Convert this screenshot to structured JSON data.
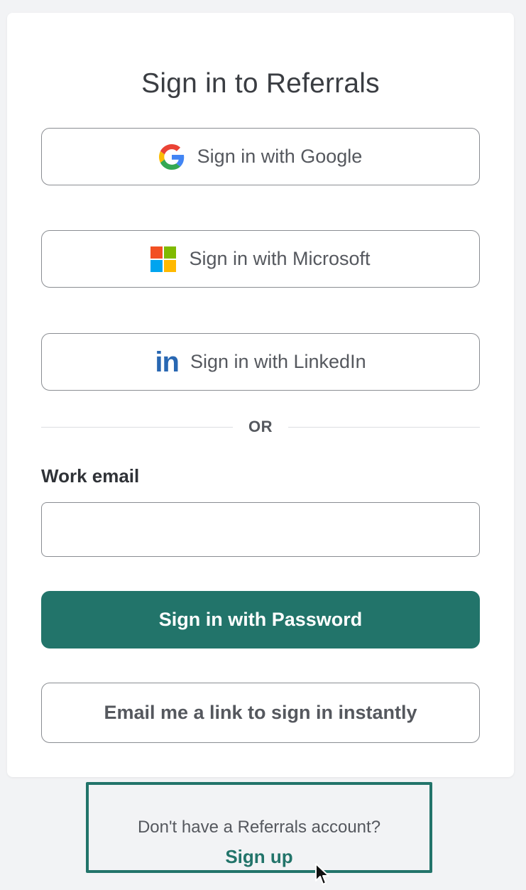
{
  "page": {
    "title": "Sign in to Referrals"
  },
  "oauth": {
    "google_label": "Sign in with Google",
    "microsoft_label": "Sign in with Microsoft",
    "linkedin_label": "Sign in with LinkedIn",
    "linkedin_icon_text": "in"
  },
  "divider": {
    "text": "OR"
  },
  "email": {
    "label": "Work email",
    "value": "",
    "placeholder": ""
  },
  "actions": {
    "password_label": "Sign in with Password",
    "magic_link_label": "Email me a link to sign in instantly"
  },
  "signup": {
    "prompt": "Don't have a Referrals account?",
    "link": "Sign up"
  },
  "colors": {
    "primary": "#22746a",
    "linkedin": "#2867b2",
    "google_blue": "#4285f4",
    "google_red": "#ea4335",
    "google_yellow": "#fbbc05",
    "google_green": "#34a853",
    "ms_red": "#f25022",
    "ms_green": "#7fba00",
    "ms_blue": "#00a4ef",
    "ms_yellow": "#ffb900"
  },
  "icons": {
    "google": "google-icon",
    "microsoft": "microsoft-icon",
    "linkedin": "linkedin-icon",
    "cursor": "mouse-cursor-icon"
  }
}
